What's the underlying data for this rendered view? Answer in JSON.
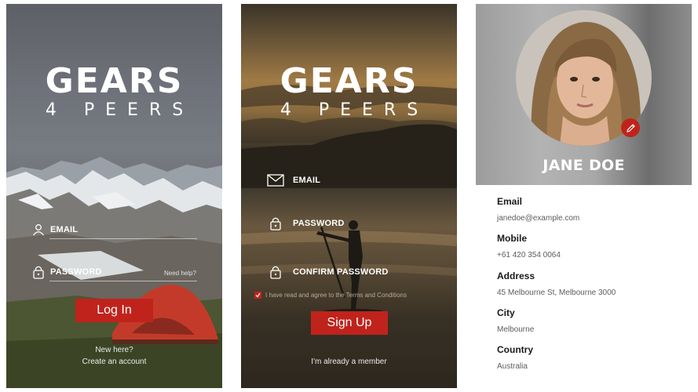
{
  "brand": {
    "name_top": "GEARS",
    "name_bottom": "4 PEERS"
  },
  "login": {
    "email_label": "EMAIL",
    "password_label": "PASSWORD",
    "help_link": "Need help?",
    "login_button": "Log In",
    "new_here": "New here?",
    "create_account": "Create an account",
    "icons": {
      "email": "user-icon",
      "password": "lock-icon"
    }
  },
  "signup": {
    "email_label": "EMAIL",
    "password_label": "PASSWORD",
    "confirm_label": "CONFIRM PASSWORD",
    "terms_text": "I have read and agree to the Terms and Conditions",
    "terms_checked": true,
    "signup_button": "Sign Up",
    "already_member": "I'm already a member",
    "icons": {
      "email": "envelope-icon",
      "password": "lock-icon",
      "confirm": "lock-icon"
    }
  },
  "profile": {
    "name": "JANE DOE",
    "fields": [
      {
        "label": "Email",
        "value": "janedoe@example.com"
      },
      {
        "label": "Mobile",
        "value": "+61 420 354 0064"
      },
      {
        "label": "Address",
        "value": "45 Melbourne St, Melbourne 3000"
      },
      {
        "label": "City",
        "value": "Melbourne"
      },
      {
        "label": "Country",
        "value": "Australia"
      }
    ]
  },
  "colors": {
    "accent": "#c0231c",
    "text_dark": "#1a1a1a",
    "text_muted": "#5c5c5c"
  }
}
